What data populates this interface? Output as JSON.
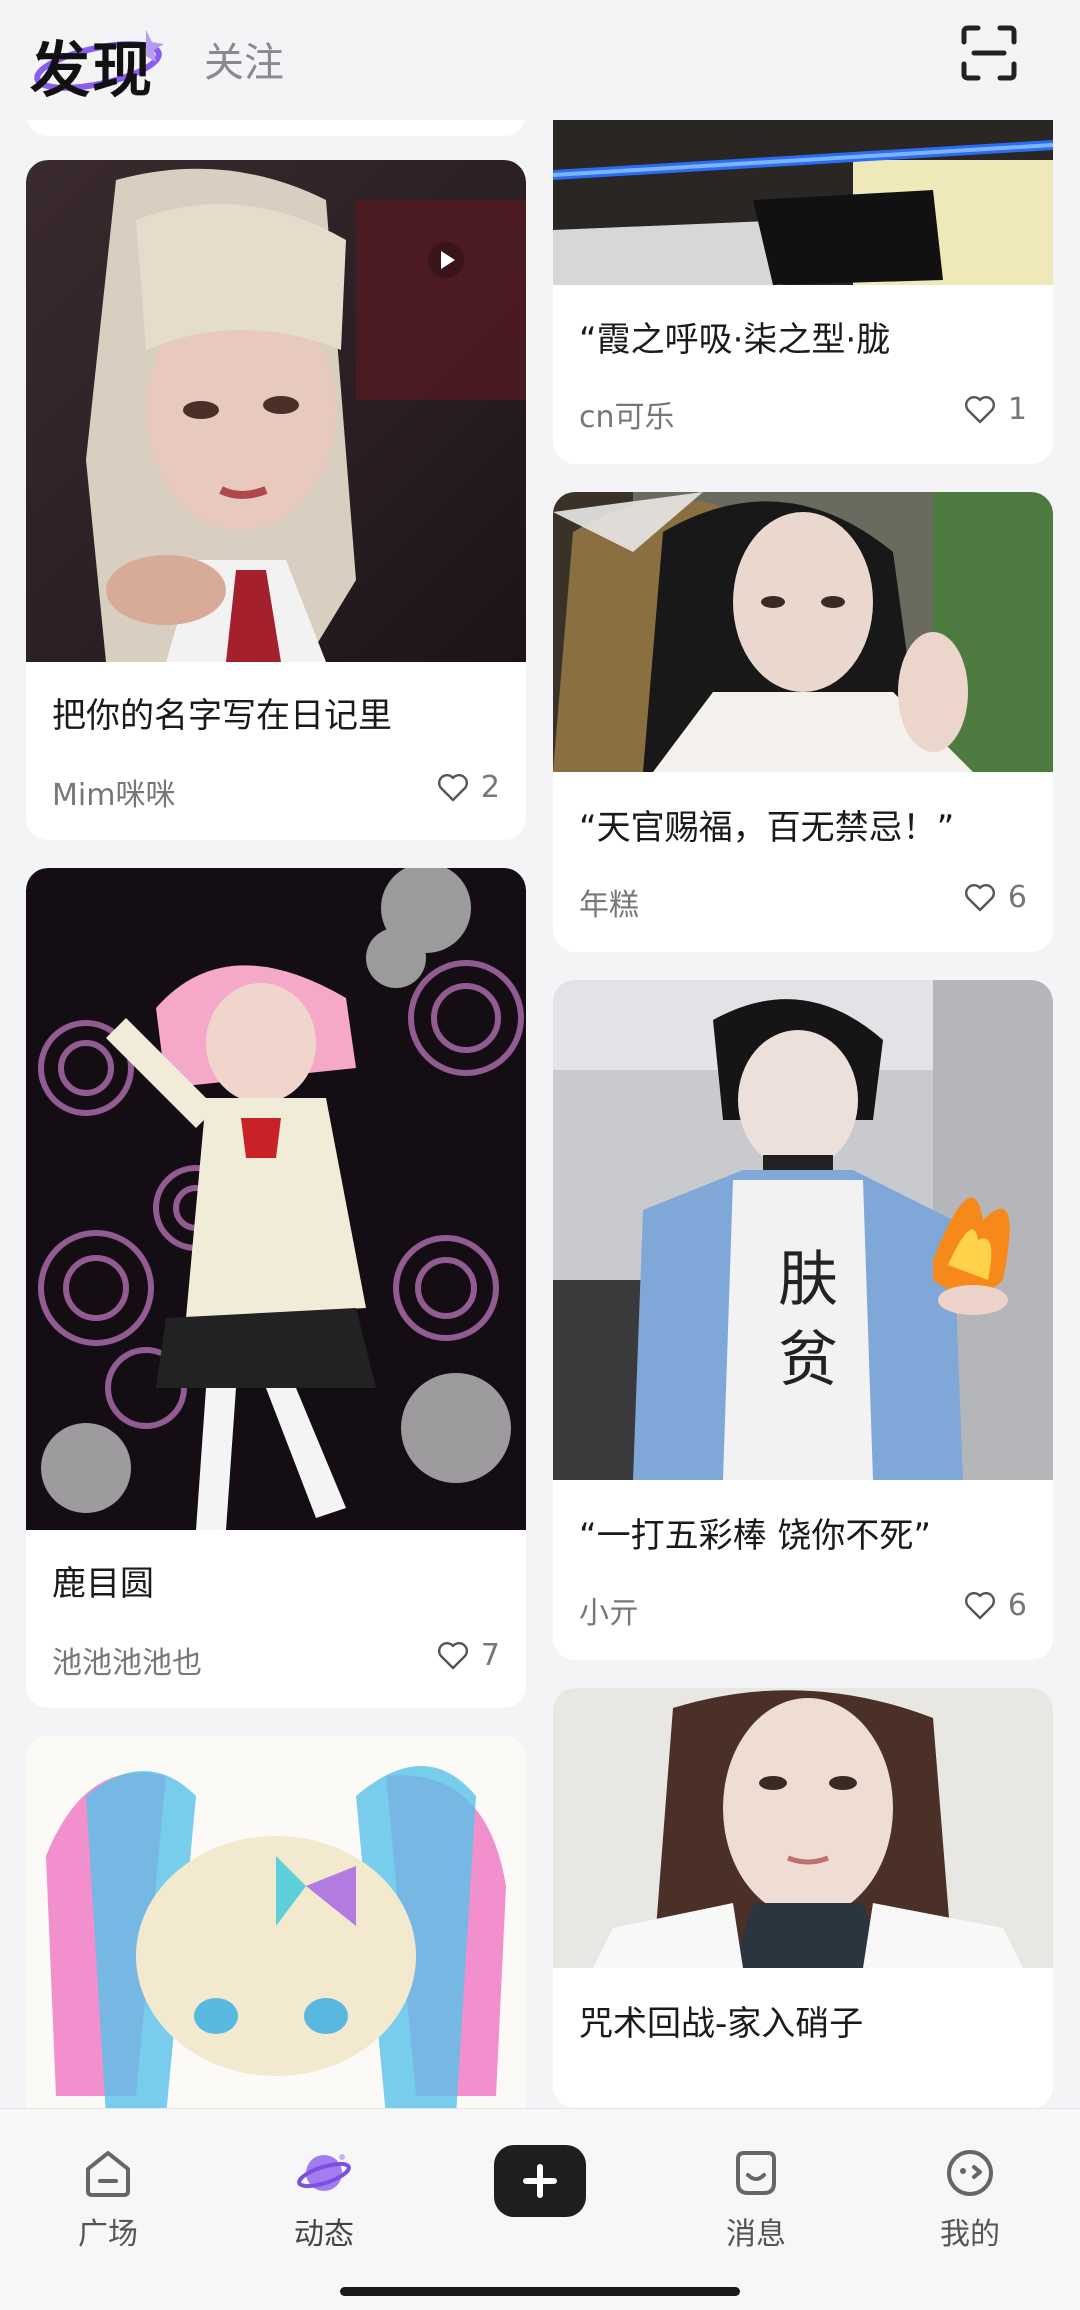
{
  "header": {
    "tabs": [
      {
        "label": "发现",
        "active": true
      },
      {
        "label": "关注",
        "active": false
      }
    ],
    "accent_color": "#8c5cf0"
  },
  "feed": {
    "left_column": [
      {
        "title": "把你的名字写在日记里",
        "author": "Mim咪咪",
        "likes": "2",
        "is_video": true
      },
      {
        "title": "鹿目圆",
        "author": "池池池池也",
        "likes": "7",
        "is_video": false
      },
      {
        "title": "",
        "author": "",
        "likes": "",
        "is_video": false
      }
    ],
    "right_column": [
      {
        "title": "“霞之呼吸·柒之型·胧",
        "author": "cn可乐",
        "likes": "1"
      },
      {
        "title": "“天官赐福，百无禁忌！”",
        "author": "年糕",
        "likes": "6"
      },
      {
        "title": "“一打五彩棒 饶你不死”",
        "author": "小亓",
        "likes": "6"
      },
      {
        "title": "咒术回战-家入硝子",
        "author": "",
        "likes": ""
      }
    ]
  },
  "bottom_nav": {
    "items": [
      {
        "label": "广场",
        "icon": "home-icon"
      },
      {
        "label": "动态",
        "icon": "planet-icon",
        "active": true
      },
      {
        "label": "消息",
        "icon": "message-icon"
      },
      {
        "label": "我的",
        "icon": "profile-icon"
      }
    ],
    "add_icon": "plus-icon"
  }
}
